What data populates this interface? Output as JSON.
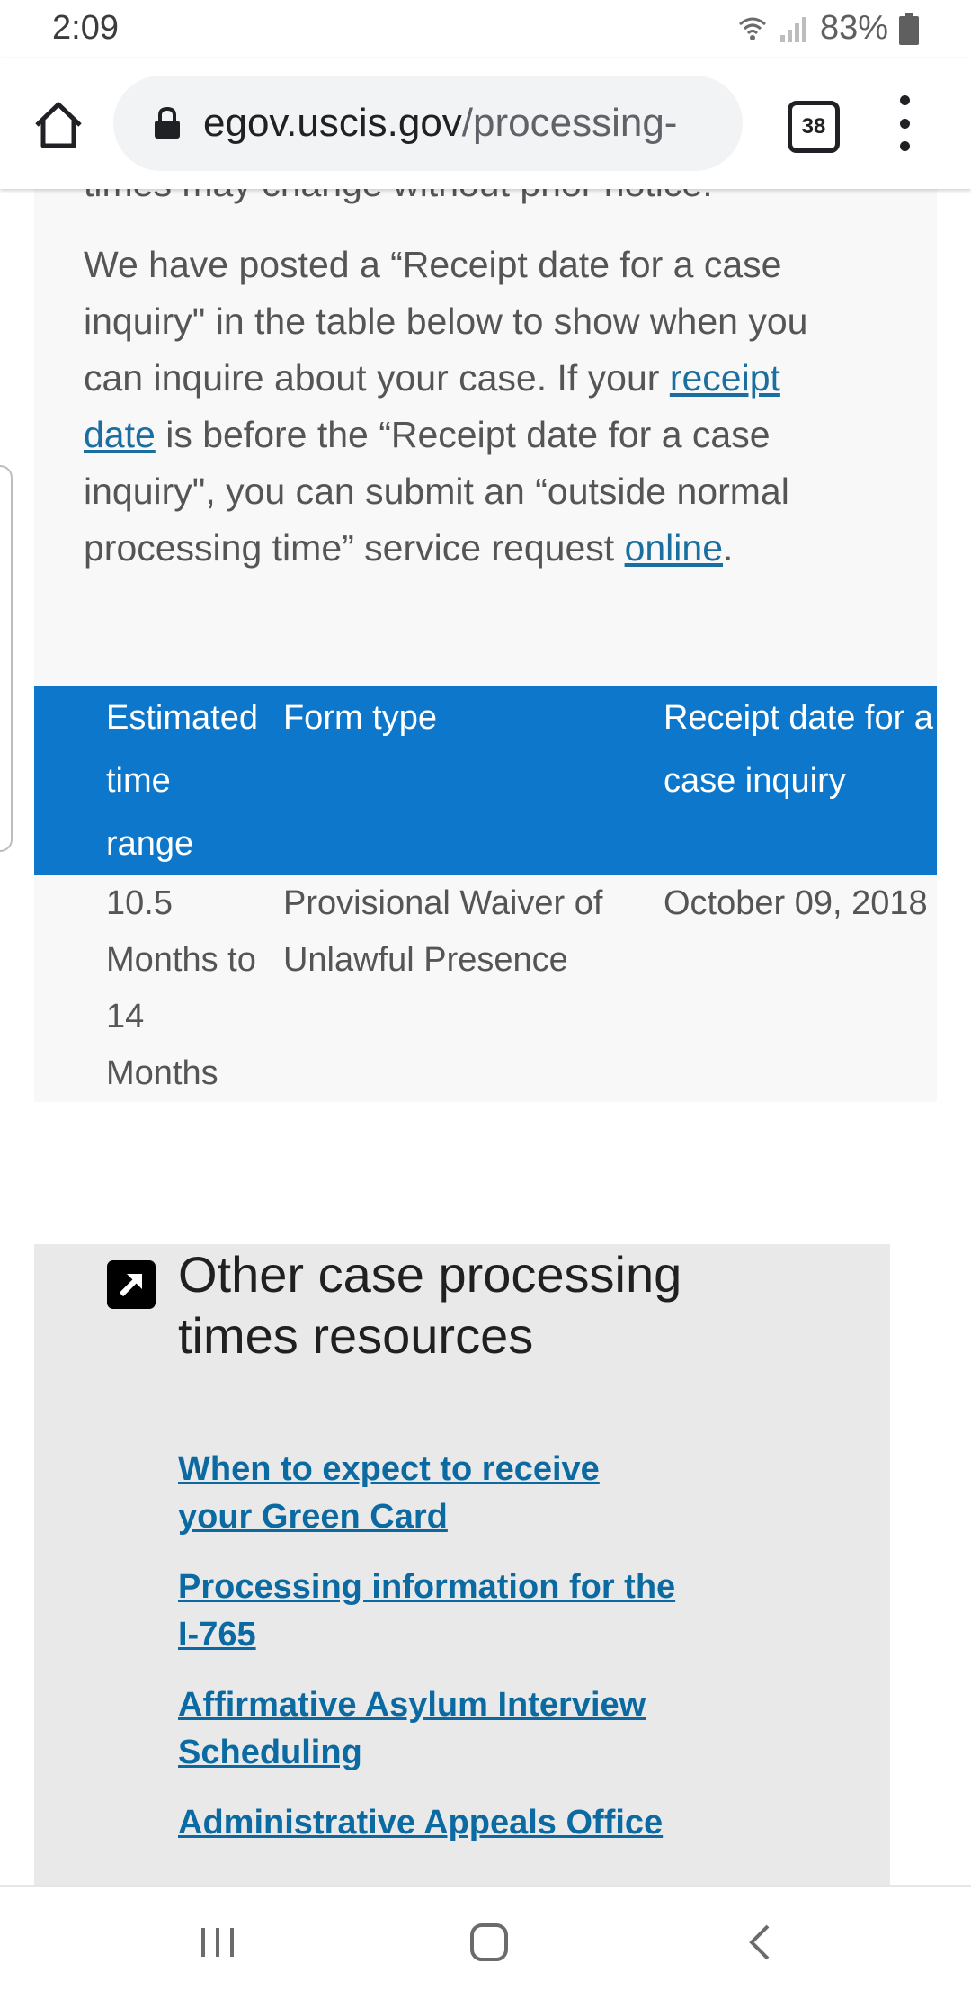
{
  "status_bar": {
    "time": "2:09",
    "battery": "83%"
  },
  "browser": {
    "url_host": "egov.uscis.gov",
    "url_path": "/processing-",
    "tab_count": "38"
  },
  "intro": {
    "cut_line": "times may change without prior notice.",
    "para_1": "We have posted a “Receipt date for a case inquiry\" in the table below to show when you can inquire about your case. If your ",
    "link_receipt_date": "receipt date",
    "para_2": " is before the “Receipt date for a case inquiry\", you can submit an “outside normal processing time” service request ",
    "link_online": "online",
    "para_3": "."
  },
  "table": {
    "headers": [
      "Estimated time range",
      "Form type",
      "Receipt date for a case inquiry"
    ],
    "rows": [
      {
        "time_range": "10.5 Months to 14 Months",
        "form_type": "Provisional Waiver of Unlawful Presence",
        "receipt_date": "October 09, 2018"
      }
    ]
  },
  "resources": {
    "title": "Other case processing times resources",
    "links": [
      "When to expect to receive your Green Card",
      "Processing information for the I-765",
      "Affirmative Asylum Interview Scheduling",
      "Administrative Appeals Office"
    ]
  },
  "colors": {
    "table_header": "#0d77cb",
    "link": "#0b6aa1",
    "resources_bg": "#e9e9e9"
  }
}
